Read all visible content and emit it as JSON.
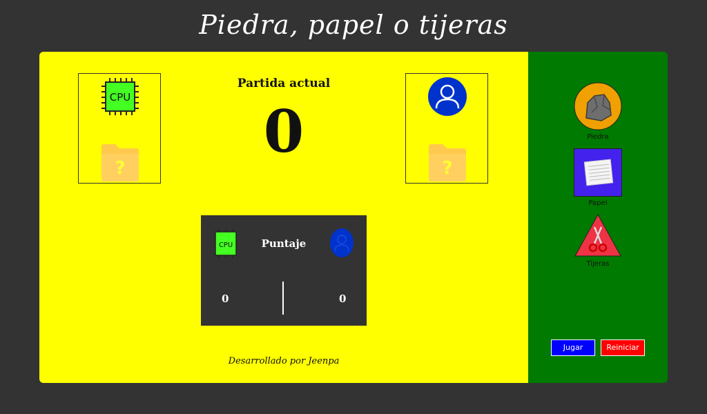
{
  "title": "Piedra, papel o tijeras",
  "match": {
    "label": "Partida actual",
    "count": "0"
  },
  "cpu": {
    "chip_label": "CPU",
    "hidden_choice": "?"
  },
  "user": {
    "hidden_choice": "?"
  },
  "score": {
    "title": "Puntaje",
    "cpu_score": "0",
    "user_score": "0",
    "cpu_chip_label": "CPU"
  },
  "footer": "Desarrollado por Jeenpa",
  "choices": [
    {
      "label": "Piedra",
      "icon": "rock-icon"
    },
    {
      "label": "Papel",
      "icon": "paper-icon"
    },
    {
      "label": "Tijeras",
      "icon": "scissors-icon"
    }
  ],
  "buttons": {
    "play": "Jugar",
    "reset": "Reiniciar"
  },
  "colors": {
    "background": "#333333",
    "board": "#ffff00",
    "panel": "#007a00",
    "cpu_chip": "#44ff22",
    "user_avatar": "#0033cc",
    "play": "#0000ff",
    "reset": "#ff0000"
  }
}
